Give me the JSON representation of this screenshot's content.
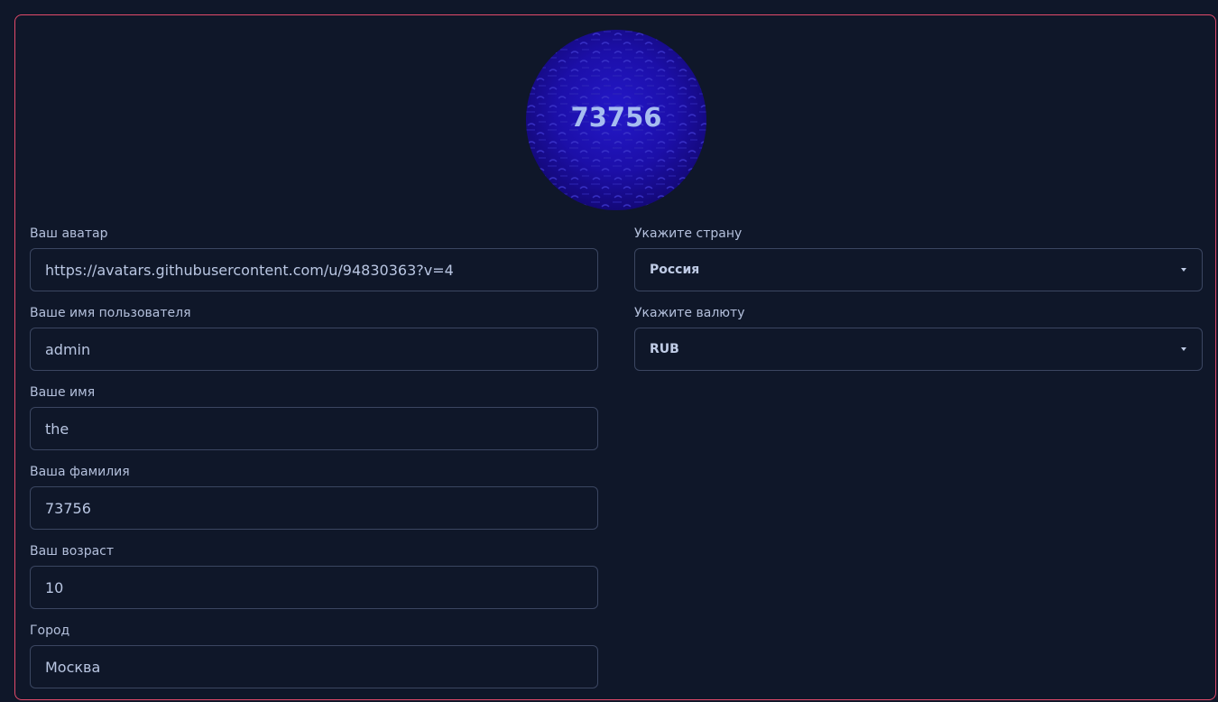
{
  "avatar": {
    "text": "73756"
  },
  "fields": {
    "avatar_url": {
      "label": "Ваш аватар",
      "value": "https://avatars.githubusercontent.com/u/94830363?v=4"
    },
    "username": {
      "label": "Ваше имя пользователя",
      "value": "admin"
    },
    "first_name": {
      "label": "Ваше имя",
      "value": "the"
    },
    "last_name": {
      "label": "Ваша фамилия",
      "value": "73756"
    },
    "age": {
      "label": "Ваш возраст",
      "value": "10"
    },
    "city": {
      "label": "Город",
      "value": "Москва"
    }
  },
  "selects": {
    "country": {
      "label": "Укажите страну",
      "value": "Россия"
    },
    "currency": {
      "label": "Укажите валюту",
      "value": "RUB"
    }
  },
  "colors": {
    "background": "#0f1729",
    "panel_border": "#e24a6a",
    "input_border": "#3b4661",
    "text": "#b9c6e2",
    "avatar_bg": "#1c0fa8"
  },
  "icons": {
    "select_caret": "caret-down-icon"
  }
}
